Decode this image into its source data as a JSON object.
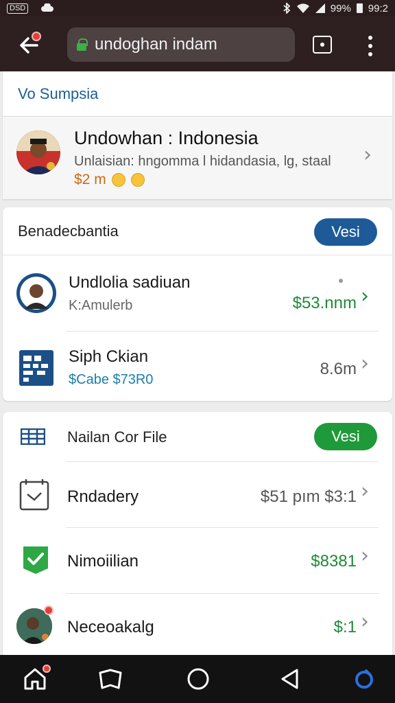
{
  "status_bar": {
    "left_box": "DSD",
    "battery_pct": "99%",
    "time": "99:2"
  },
  "browser": {
    "url": "undoghan indam"
  },
  "page": {
    "title": "Vo  Sumpsia"
  },
  "profile": {
    "name": "Undowhan : Indonesia",
    "subtitle": "Unlaisian: hngomma l hidandasia, lg, staal",
    "price": "$2 m"
  },
  "section_1": {
    "title": "Benadecbantia",
    "badge": "Vesi",
    "badge_color": "#1e5a97",
    "items": [
      {
        "title": "Undlolia sadiuan",
        "subtitle": "K:Amulerb",
        "value": "$53.nnm"
      },
      {
        "title": "Siph Ckian",
        "subtitle": "$Cabe $73R0",
        "value": "8.6m"
      }
    ]
  },
  "section_2": {
    "title": "Nailan Cor File",
    "badge": "Vesi",
    "badge_color": "#1e9a3a",
    "items": [
      {
        "title": "Rndadery",
        "value": "$51 pım $3:1"
      },
      {
        "title": "Nimoiilian",
        "value": "$8381"
      },
      {
        "title": "Neceoakalg",
        "value": "$:1"
      }
    ]
  },
  "colors": {
    "accent_blue": "#1c5d97",
    "green": "#1e8a36",
    "price_orange": "#c86a14",
    "toolbar": "#2e2021"
  }
}
